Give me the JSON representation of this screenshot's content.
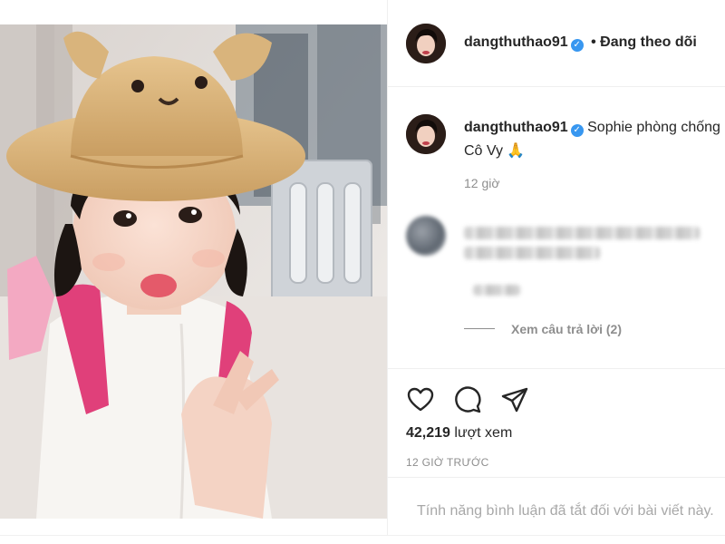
{
  "header": {
    "username": "dangthuthao91",
    "follow_status": "• Đang theo dõi"
  },
  "caption": {
    "username": "dangthuthao91",
    "text": "Sophie phòng chống Cô Vy 🙏",
    "time": "12 giờ"
  },
  "comment": {
    "view_replies": "Xem câu trả lời (2)"
  },
  "actions": {
    "like_icon": "heart-icon",
    "comment_icon": "comment-bubble-icon",
    "share_icon": "paper-plane-icon",
    "views_count": "42,219",
    "views_label": "lượt xem",
    "post_time": "12 giờ trước"
  },
  "footer": {
    "comments_disabled": "Tính năng bình luận đã tắt đối với bài viết này."
  },
  "colors": {
    "verified": "#3897f0",
    "text": "#262626",
    "muted": "#8e8e8e",
    "divider": "#efefef"
  }
}
